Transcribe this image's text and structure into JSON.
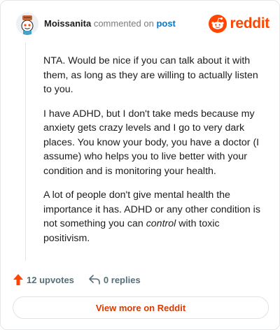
{
  "header": {
    "author": "Moissanita",
    "action_text": "commented on",
    "post_link": "post",
    "brand_name": "reddit"
  },
  "comment": {
    "paragraph_1": "NTA. Would be nice if you can talk about it with them, as long as they are willing to actually listen to you.",
    "paragraph_2": "I have ADHD, but I don't take meds because my anxiety gets crazy levels and I go to very dark places. You know your body, you have a doctor (I assume) who helps you to live better with your condition and is monitoring your health.",
    "paragraph_3_start": "A lot of people don't give mental health the importance it has. ADHD or any other condition is not something you can ",
    "paragraph_3_emphasis": "control",
    "paragraph_3_end": " with toxic positivism."
  },
  "actions": {
    "upvotes_label": "12 upvotes",
    "replies_label": "0 replies"
  },
  "footer": {
    "view_more_label": "View more on Reddit"
  },
  "colors": {
    "brand": "#ff4500",
    "upvote": "#ff4500",
    "link": "#0079d3",
    "view_more_text": "#d93a00"
  },
  "icons": {
    "avatar": "snoo-avatar",
    "logo": "reddit-logo-icon",
    "upvote": "upvote-arrow-icon",
    "reply": "reply-arrow-icon"
  }
}
